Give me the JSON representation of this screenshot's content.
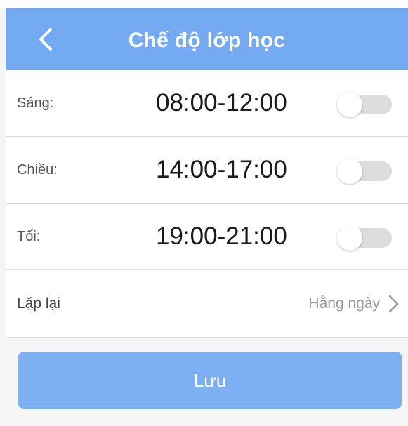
{
  "header": {
    "title": "Chế độ lớp học",
    "back_icon": "chevron-left-icon",
    "background_color": "#73aaf2"
  },
  "schedule": [
    {
      "label": "Sáng:",
      "time": "08:00-12:00",
      "enabled": false
    },
    {
      "label": "Chiều:",
      "time": "14:00-17:00",
      "enabled": false
    },
    {
      "label": "Tối:",
      "time": "19:00-21:00",
      "enabled": false
    }
  ],
  "repeat": {
    "label": "Lặp lại",
    "value": "Hằng ngày",
    "icon": "chevron-right-icon"
  },
  "save": {
    "label": "Lưu",
    "color": "#7db0f2"
  }
}
